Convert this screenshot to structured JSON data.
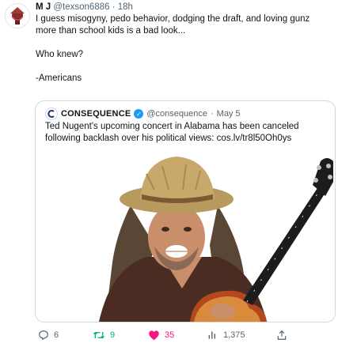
{
  "tweet": {
    "display_name": "M J",
    "handle": "@texson6886",
    "separator": "·",
    "time": "18h",
    "text_line1": "I guess misogyny, pedo behavior, dodging the draft, and loving gunz more than school kids is a bad look...",
    "text_line2": "Who knew?",
    "text_line3": "-Americans"
  },
  "quote": {
    "display_name": "CONSEQUENCE",
    "handle": "@consequence",
    "separator": "·",
    "date": "May 5",
    "text": "Ted Nugent's upcoming concert in Alabama has been canceled following backlash over his political views: cos.lv/tr8l50Oh0ys"
  },
  "actions": {
    "reply_count": "6",
    "retweet_count": "9",
    "like_count": "35",
    "views_count": "1,375"
  },
  "colors": {
    "text": "#0f1419",
    "secondary": "#536471",
    "retweet": "#00ba7c",
    "like": "#f91880",
    "verified": "#1d9bf0",
    "border": "#cfd9de"
  },
  "icons": [
    "profile-avatar-icon",
    "consequence-logo-icon",
    "verified-badge-icon",
    "reply-icon",
    "retweet-icon",
    "like-icon",
    "views-icon",
    "share-icon"
  ]
}
